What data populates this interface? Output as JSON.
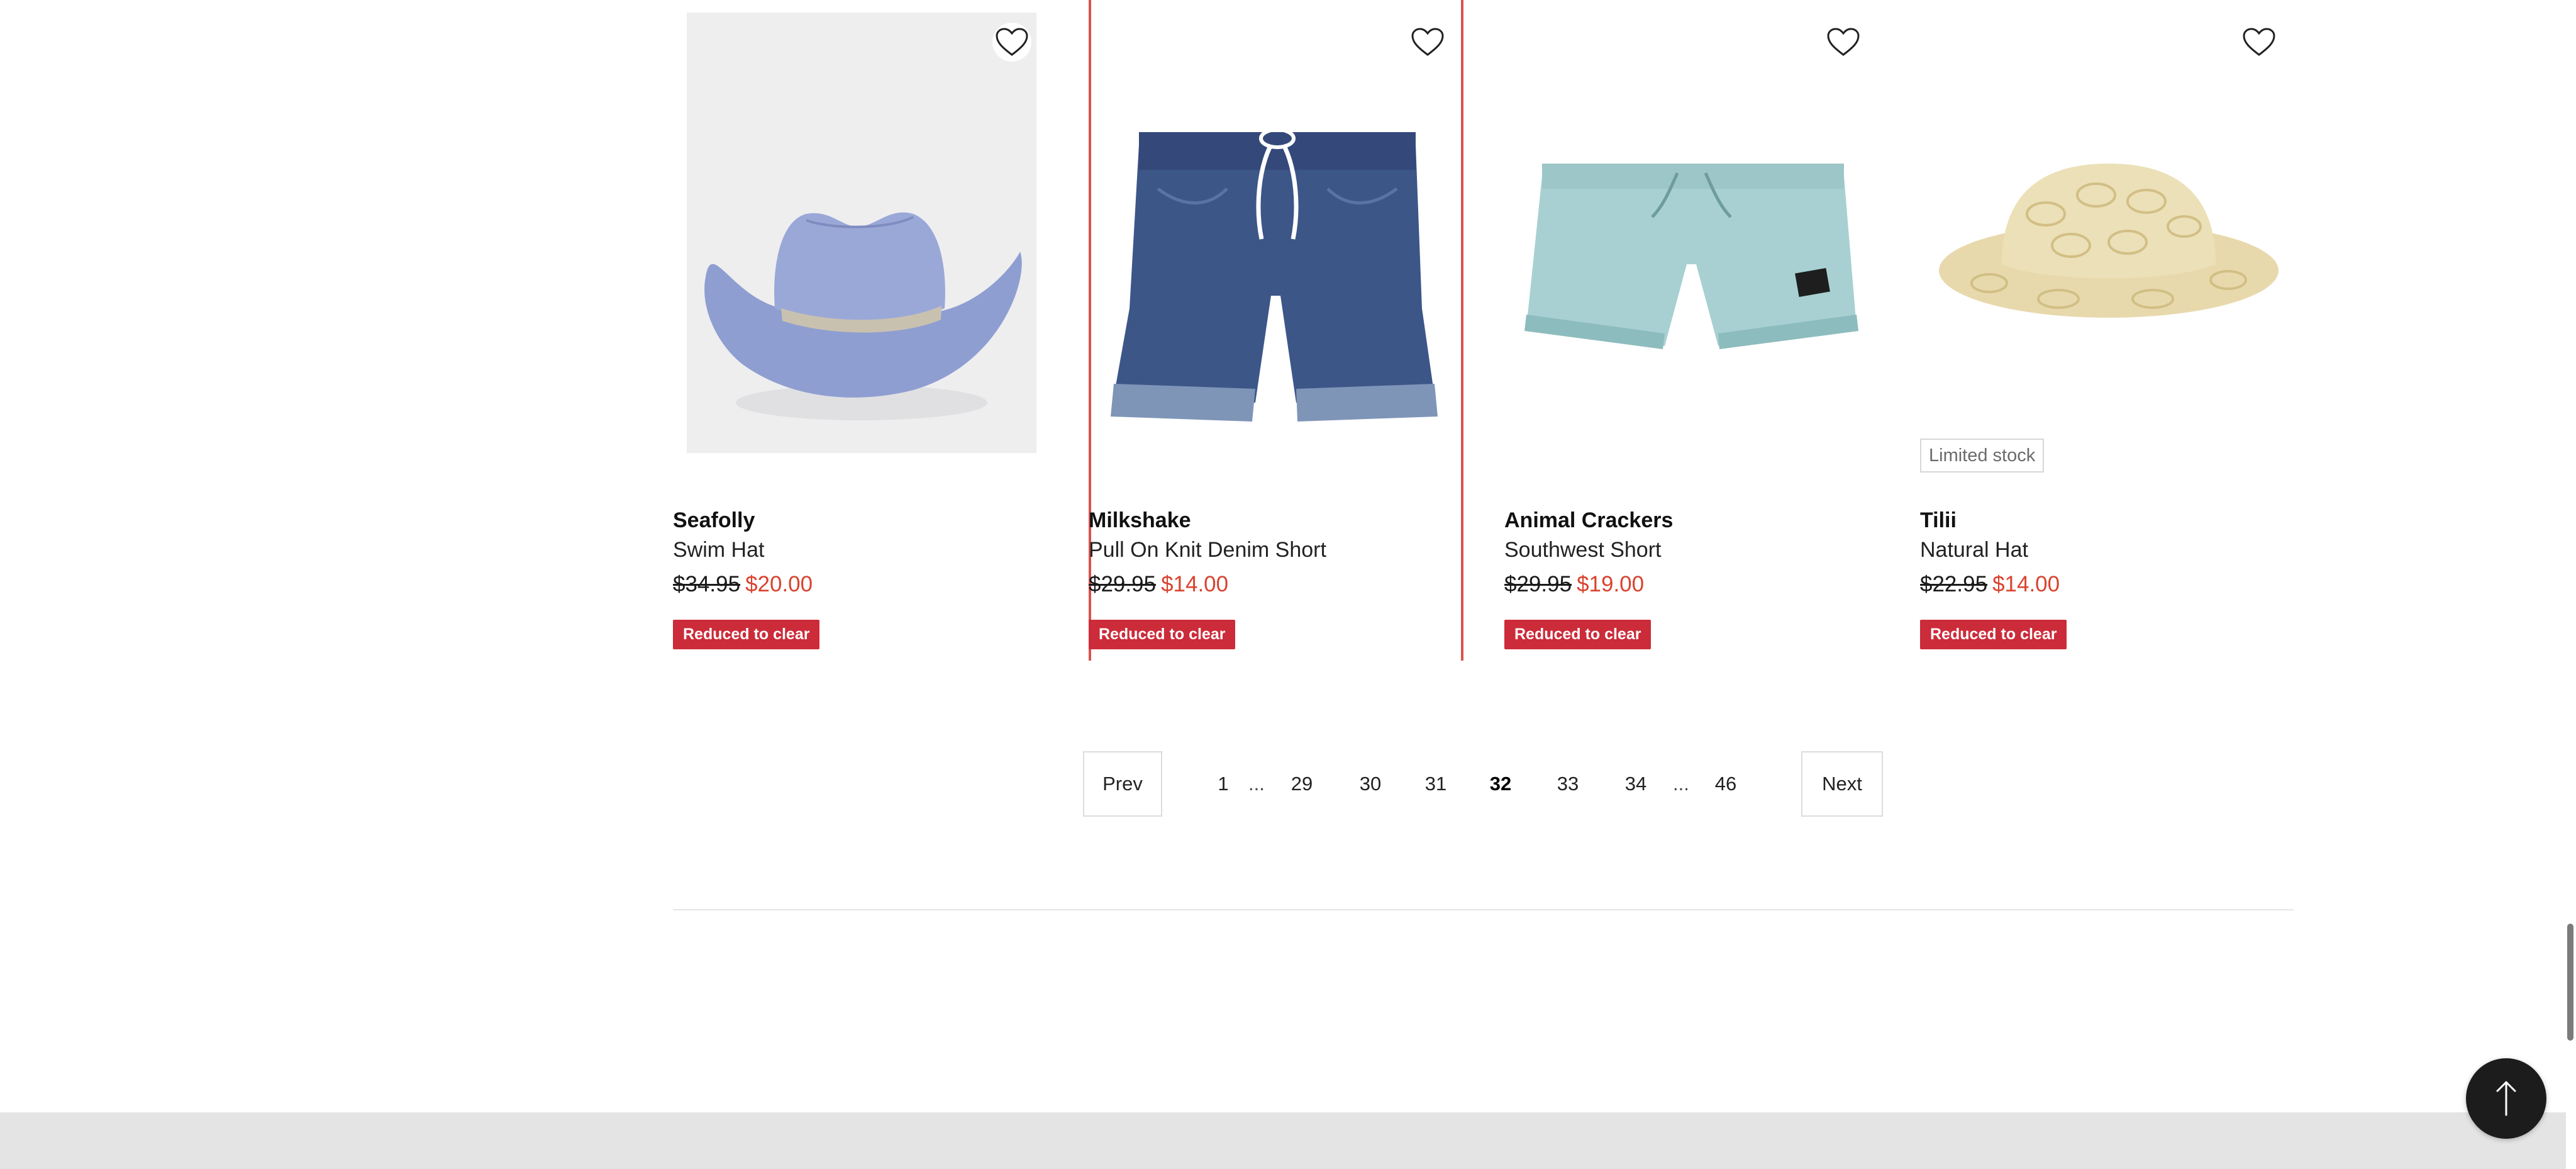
{
  "products": [
    {
      "brand": "Seafolly",
      "name": "Swim Hat",
      "was_price": "$34.95",
      "now_price": "$20.00",
      "tag": "Reduced to clear",
      "image": "blue-straw-cowboy-hat",
      "favourite_icon": "heart-outline-icon"
    },
    {
      "brand": "Milkshake",
      "name": "Pull On Knit Denim Short",
      "was_price": "$29.95",
      "now_price": "$14.00",
      "tag": "Reduced to clear",
      "image": "denim-shorts",
      "favourite_icon": "heart-outline-icon"
    },
    {
      "brand": "Animal Crackers",
      "name": "Southwest Short",
      "was_price": "$29.95",
      "now_price": "$19.00",
      "tag": "Reduced to clear",
      "image": "light-blue-shorts",
      "favourite_icon": "heart-outline-icon"
    },
    {
      "brand": "Tilii",
      "name": "Natural Hat",
      "was_price": "$22.95",
      "now_price": "$14.00",
      "tag": "Reduced to clear",
      "stock_badge": "Limited stock",
      "image": "natural-crochet-bucket-hat",
      "favourite_icon": "heart-outline-icon"
    }
  ],
  "pagination": {
    "prev_label": "Prev",
    "next_label": "Next",
    "ellipsis": "...",
    "pages": [
      "1",
      "29",
      "30",
      "31",
      "32",
      "33",
      "34",
      "46"
    ],
    "current_page": "32"
  },
  "back_to_top_icon": "arrow-up-icon",
  "colors": {
    "sale_price": "#d9432f",
    "sale_tag": "#cc2b3a",
    "highlight_outline": "#d9534f",
    "footer": "#e4e4e4",
    "back_to_top": "#1c1c1c"
  }
}
